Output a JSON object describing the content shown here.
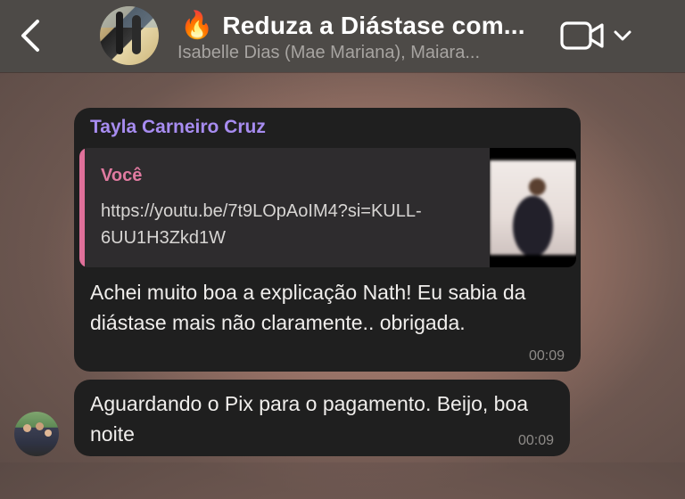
{
  "header": {
    "title": "Reduza a Diástase com...",
    "title_icon": "fire-icon",
    "subtitle": "Isabelle Dias (Mae Mariana), Maiara...",
    "back_icon": "chevron-left-icon",
    "video_icon": "video-camera-icon",
    "dropdown_icon": "chevron-down-icon"
  },
  "messages": [
    {
      "sender": "Tayla Carneiro Cruz",
      "reply": {
        "author": "Você",
        "text": "https://youtu.be/7t9LOpAoIM4?si=KULL-6UU1H3Zkd1W"
      },
      "text": "Achei muito boa a explicação Nath! Eu sabia da diástase mais não claramente.. obrigada.",
      "time": "00:09"
    },
    {
      "text": "Aguardando o Pix para o pagamento. Beijo, boa noite",
      "time": "00:09"
    }
  ],
  "colors": {
    "header_bg": "#4d4a47",
    "bubble_bg": "#1f1f1f",
    "sender_name": "#a78cf0",
    "reply_accent": "#e0709a"
  }
}
